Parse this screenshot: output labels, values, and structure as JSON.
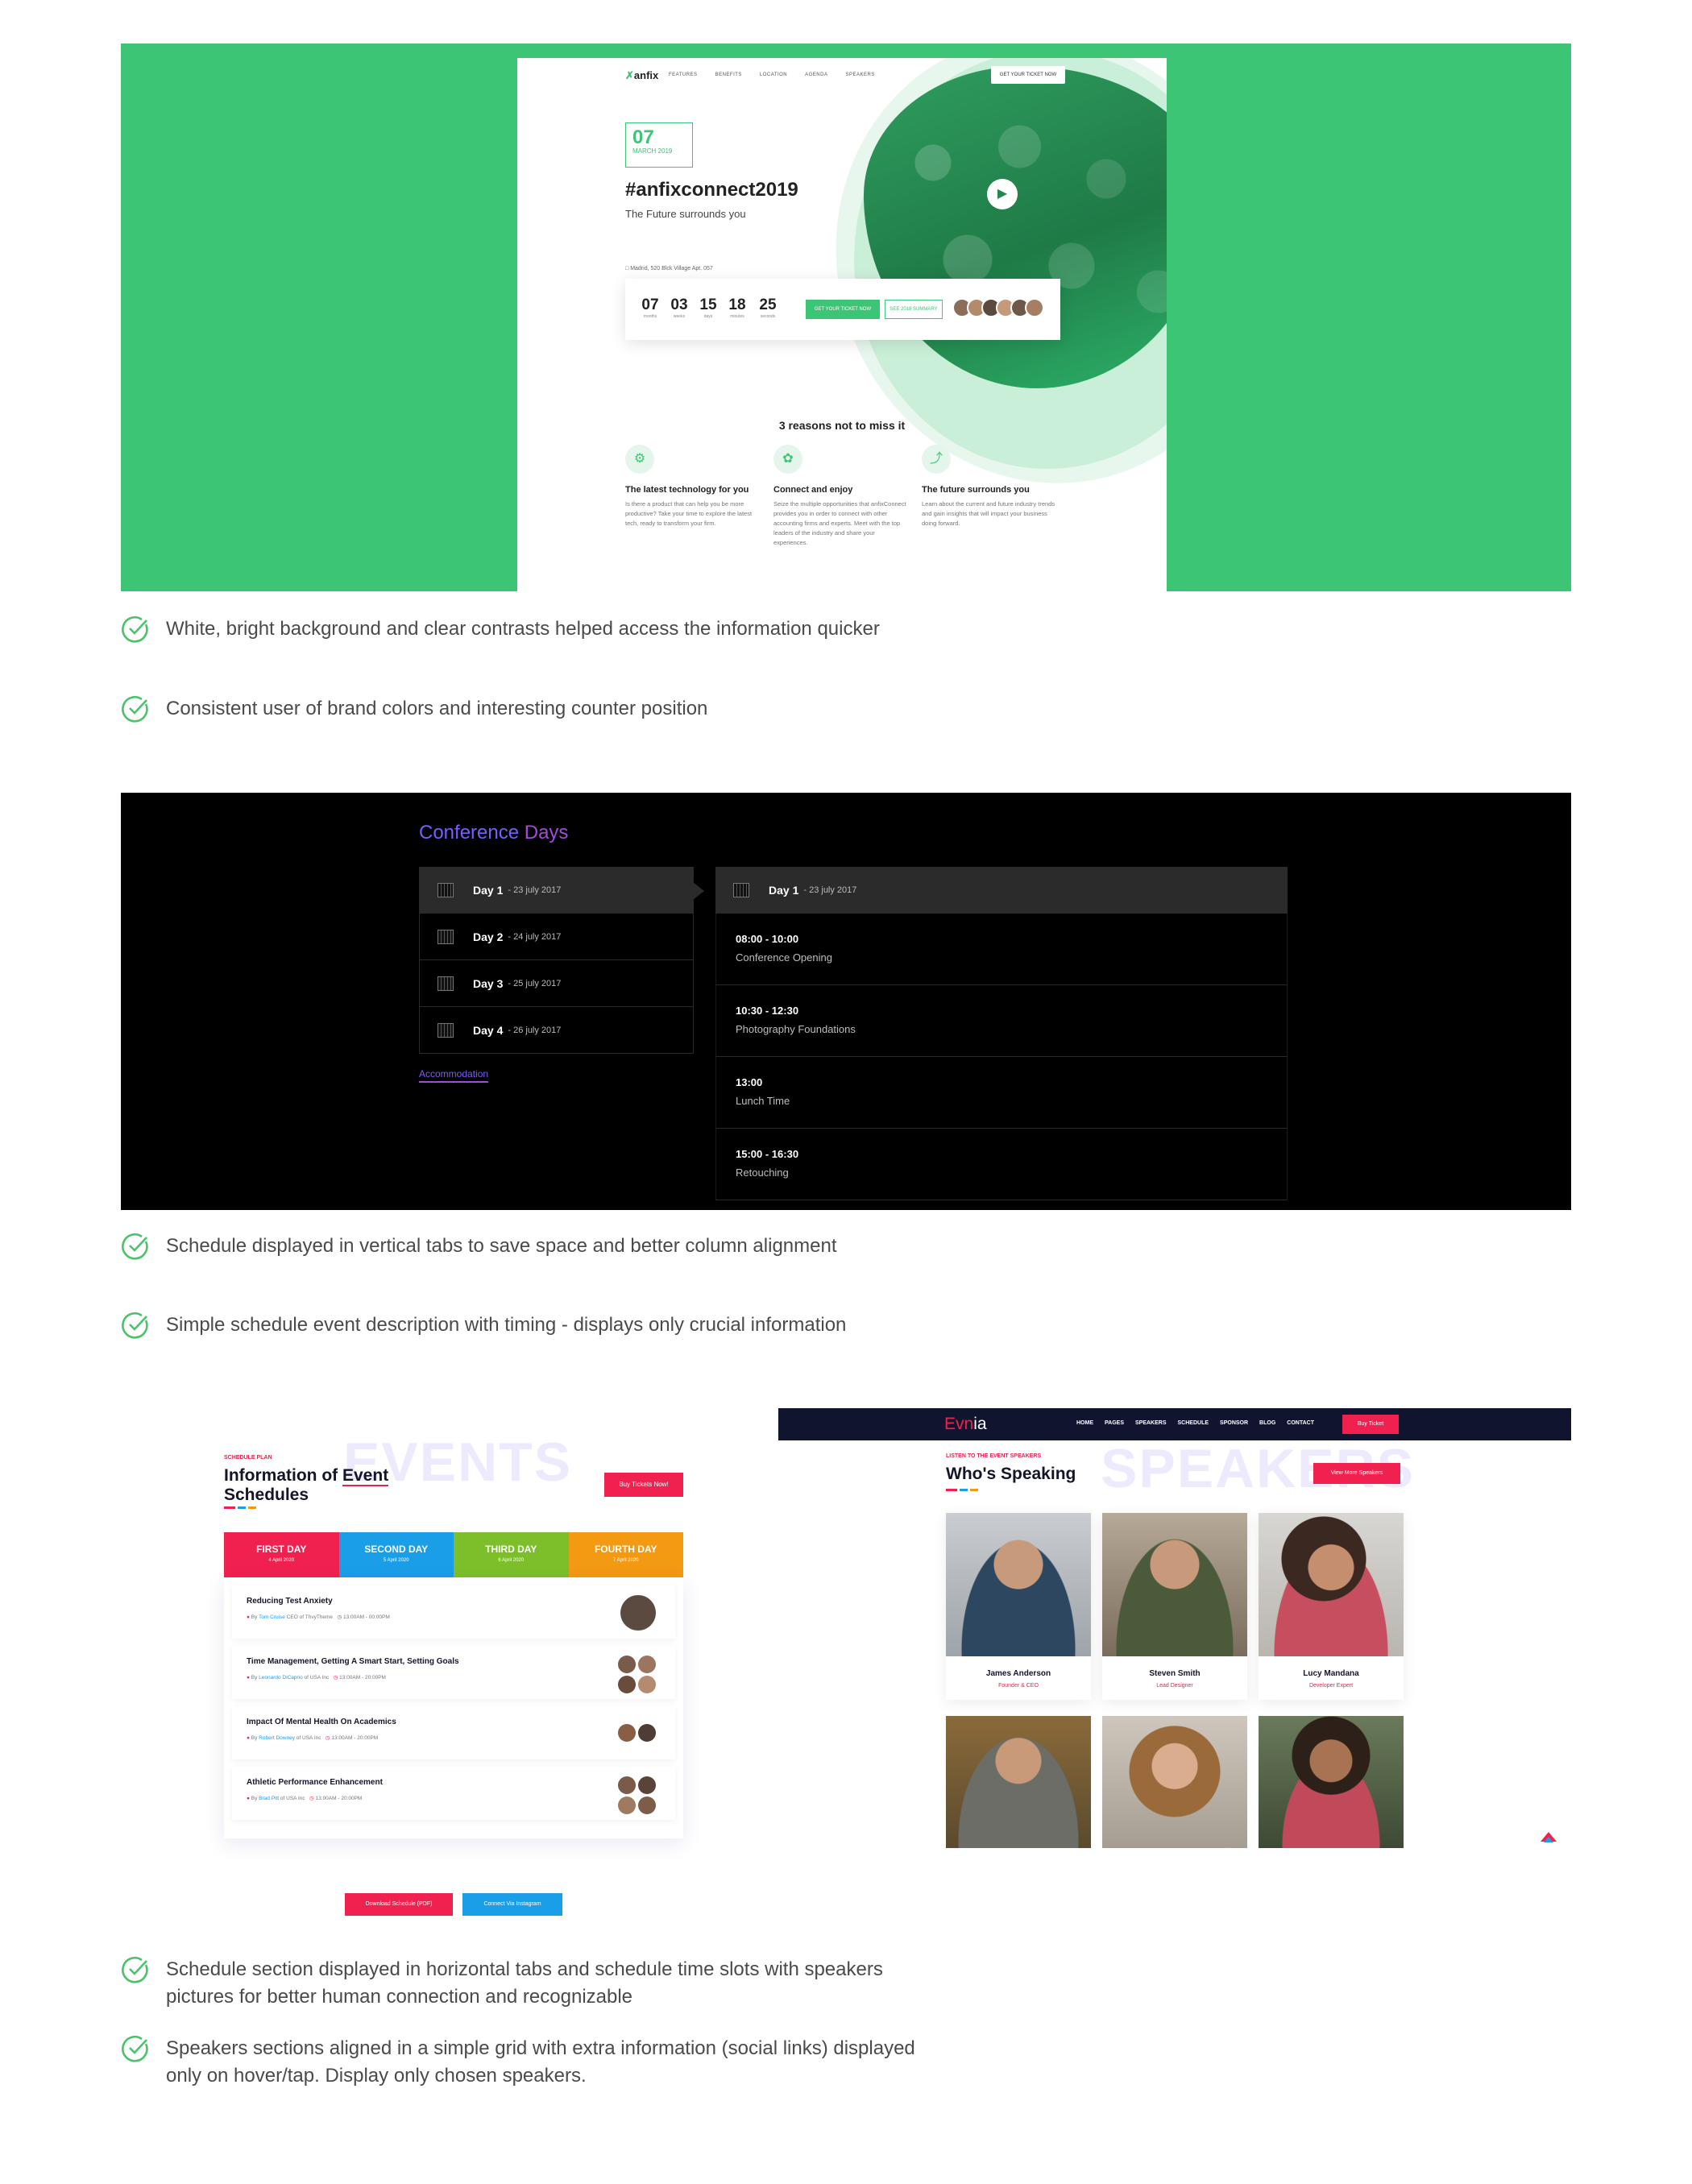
{
  "anfix": {
    "logo": "anfix",
    "nav": [
      "FEATURES",
      "BENEFITS",
      "LOCATION",
      "AGENDA",
      "SPEAKERS"
    ],
    "nav_button": "GET YOUR TICKET NOW",
    "date_day": "07",
    "date_month": "MARCH 2019",
    "hashtag": "#anfixconnect2019",
    "subtitle": "The Future surrounds you",
    "location": "Madrid, 520 Blck Village Apt. 057",
    "counter": [
      {
        "value": "07",
        "label": "months"
      },
      {
        "value": "03",
        "label": "weeks"
      },
      {
        "value": "15",
        "label": "days"
      },
      {
        "value": "18",
        "label": "minutes"
      },
      {
        "value": "25",
        "label": "seconds"
      }
    ],
    "get_ticket": "GET YOUR TICKET NOW",
    "summary": "SEE 2018 SUMMARY",
    "reasons_title": "3 reasons not to miss it",
    "features": [
      {
        "title": "The latest technology for you",
        "text": "Is there a product that can help you be more productive? Take your time to explore the latest tech, ready to transform your firm."
      },
      {
        "title": "Connect and enjoy",
        "text": "Seize the multiple opportunities that anfixConnect provides you in order to connect with other accounting firms and experts. Meet with the top leaders of the industry and share your experiences."
      },
      {
        "title": "The future surrounds you",
        "text": "Learn about the current and future industry trends and gain insights that will impact your business doing forward."
      }
    ],
    "brand_color": "#3dc576"
  },
  "bullets1": [
    "White, bright background and clear contrasts helped access the information quicker",
    "Consistent user of brand colors and interesting counter position"
  ],
  "conference": {
    "title_a": "Conference",
    "title_b": "Days",
    "days": [
      {
        "label": "Day 1",
        "date": "- 23 july 2017"
      },
      {
        "label": "Day 2",
        "date": "- 24 july 2017"
      },
      {
        "label": "Day 3",
        "date": "- 25 july 2017"
      },
      {
        "label": "Day 4",
        "date": "- 26 july 2017"
      }
    ],
    "accommodation": "Accommodation",
    "panel_day": "Day 1",
    "panel_date": "- 23 july 2017",
    "slots": [
      {
        "time": "08:00 - 10:00",
        "name": "Conference Opening"
      },
      {
        "time": "10:30 - 12:30",
        "name": "Photography Foundations"
      },
      {
        "time": "13:00",
        "name": "Lunch Time"
      },
      {
        "time": "15:00 - 16:30",
        "name": "Retouching"
      }
    ]
  },
  "bullets2": [
    "Schedule displayed in vertical tabs to save space and better column alignment",
    "Simple schedule event description with timing - displays only crucial information"
  ],
  "events": {
    "bg_word": "EVENTS",
    "kicker": "SCHEDULE PLAN",
    "title_a": "Information of",
    "title_b": "Event",
    "title_c": "Schedules",
    "buy_button": "Buy Tickets Now!",
    "tabs": [
      {
        "name": "FIRST DAY",
        "date": "4 April 2020",
        "color": "#f0214f"
      },
      {
        "name": "SECOND DAY",
        "date": "5 April 2020",
        "color": "#1b9ee8"
      },
      {
        "name": "THIRD DAY",
        "date": "6 April 2020",
        "color": "#7dbf2a"
      },
      {
        "name": "FOURTH DAY",
        "date": "7 April 2020",
        "color": "#f39a12"
      }
    ],
    "items": [
      {
        "title": "Reducing Test Anxiety",
        "by": "By",
        "speaker": "Tom Cruise",
        "org": "CEO of ThvyTheme",
        "time": "13:00AM - 00:00PM"
      },
      {
        "title": "Time Management, Getting A Smart Start, Setting Goals",
        "by": "By",
        "speaker": "Leonardo DiCaprio",
        "org": "of USA Inc",
        "time": "13:00AM - 20:00PM"
      },
      {
        "title": "Impact Of Mental Health On Academics",
        "by": "By",
        "speaker": "Robert Downey",
        "org": "of USA Inc",
        "time": "13:00AM - 20:00PM"
      },
      {
        "title": "Athletic Performance Enhancement",
        "by": "By",
        "speaker": "Brad Pitt",
        "org": "of USA Inc",
        "time": "13:00AM - 20:00PM"
      }
    ],
    "download": "Download Schedule (PDF)",
    "connect": "Connect Via Instagram"
  },
  "evnia": {
    "logo_a": "Evn",
    "logo_b": "ia",
    "menu": [
      "HOME",
      "PAGES",
      "SPEAKERS",
      "SCHEDULE",
      "SPONSOR",
      "BLOG",
      "CONTACT"
    ],
    "buy": "Buy Ticket",
    "bg_word": "SPEAKERS",
    "kicker": "LISTEN TO THE EVENT SPEAKERS",
    "title": "Who's Speaking",
    "more": "View More Speakers",
    "speakers": [
      {
        "name": "James Anderson",
        "role": "Founder & CEO"
      },
      {
        "name": "Steven Smith",
        "role": "Lead Designer"
      },
      {
        "name": "Lucy Mandana",
        "role": "Developer Expert"
      }
    ]
  },
  "bullets3": [
    "Schedule section displayed in horizontal tabs and schedule time slots with speakers pictures for better human connection and recognizable",
    "Speakers sections aligned in a simple grid with extra information (social links) displayed only on hover/tap. Display only chosen speakers."
  ],
  "check_color": "#4cc36a"
}
